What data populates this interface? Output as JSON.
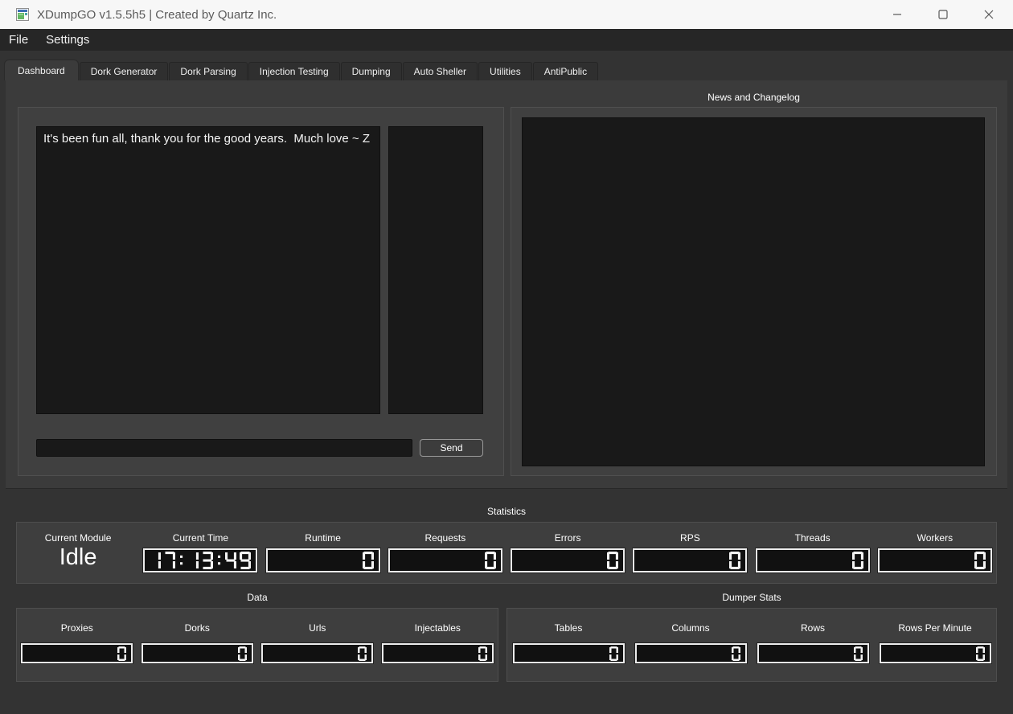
{
  "window": {
    "title": "XDumpGO v1.5.5h5 | Created by Quartz Inc.",
    "controls": [
      {
        "name": "minimize",
        "icon": "minimize-icon"
      },
      {
        "name": "maximize",
        "icon": "maximize-icon"
      },
      {
        "name": "close",
        "icon": "close-icon"
      }
    ]
  },
  "menu": {
    "items": [
      {
        "label": "File"
      },
      {
        "label": "Settings"
      }
    ]
  },
  "tabs": [
    {
      "label": "Dashboard",
      "active": true
    },
    {
      "label": "Dork Generator",
      "active": false
    },
    {
      "label": "Dork Parsing",
      "active": false
    },
    {
      "label": "Injection Testing",
      "active": false
    },
    {
      "label": "Dumping",
      "active": false
    },
    {
      "label": "Auto Sheller",
      "active": false
    },
    {
      "label": "Utilities",
      "active": false
    },
    {
      "label": "AntiPublic",
      "active": false
    }
  ],
  "chat": {
    "message": "It's been fun all, thank you for the good years.  Much love ~ Z",
    "input_value": "",
    "send_label": "Send"
  },
  "news": {
    "title": "News and Changelog",
    "content": ""
  },
  "statistics": {
    "title": "Statistics",
    "current_module": {
      "label": "Current Module",
      "value": "Idle"
    },
    "displays": [
      {
        "label": "Current Time",
        "value": "17:13:49"
      },
      {
        "label": "Runtime",
        "value": "0"
      },
      {
        "label": "Requests",
        "value": "0"
      },
      {
        "label": "Errors",
        "value": "0"
      },
      {
        "label": "RPS",
        "value": "0"
      },
      {
        "label": "Threads",
        "value": "0"
      },
      {
        "label": "Workers",
        "value": "0"
      }
    ]
  },
  "data_section": {
    "title": "Data",
    "displays": [
      {
        "label": "Proxies",
        "value": "0"
      },
      {
        "label": "Dorks",
        "value": "0"
      },
      {
        "label": "Urls",
        "value": "0"
      },
      {
        "label": "Injectables",
        "value": "0"
      }
    ]
  },
  "dumper_stats": {
    "title": "Dumper Stats",
    "displays": [
      {
        "label": "Tables",
        "value": "0"
      },
      {
        "label": "Columns",
        "value": "0"
      },
      {
        "label": "Rows",
        "value": "0"
      },
      {
        "label": "Rows Per Minute",
        "value": "0"
      }
    ]
  },
  "colors": {
    "titlebar_bg": "#f7f7f7",
    "menubar_bg": "#262626",
    "window_bg": "#333333",
    "panel_bg": "#3b3b3b",
    "groupbox_bg": "#404040",
    "textarea_bg": "#191919",
    "lcd_bg": "#111111",
    "lcd_border": "#ececec",
    "lcd_digit": "#f2f2f2",
    "text_light": "#ffffff"
  }
}
